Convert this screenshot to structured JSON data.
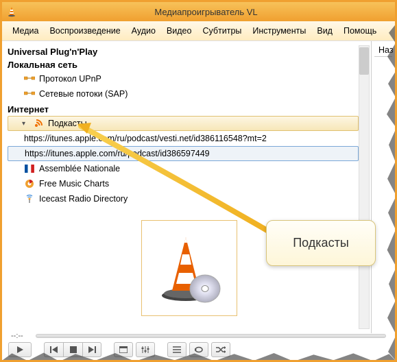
{
  "window": {
    "title": "Медиапроигрыватель VL"
  },
  "menubar": [
    "Медиа",
    "Воспроизведение",
    "Аудио",
    "Видео",
    "Субтитры",
    "Инструменты",
    "Вид",
    "Помощь"
  ],
  "sidebar": {
    "header": "Universal Plug'n'Play",
    "local_section": "Локальная сеть",
    "local_items": [
      "Протокол UPnP",
      "Сетевые потоки (SAP)"
    ],
    "internet_section": "Интернет",
    "podcasts_label": "Подкасты",
    "podcast_urls": [
      "https://itunes.apple.com/ru/podcast/vesti.net/id386116548?mt=2",
      "https://itunes.apple.com/ru/podcast/id386597449"
    ],
    "internet_items": [
      "Assemblée Nationale",
      "Free Music Charts",
      "Icecast Radio Directory"
    ]
  },
  "right_panel": {
    "column": "Наз"
  },
  "callout": {
    "text": "Подкасты"
  },
  "controls": {
    "elapsed": "--:--"
  }
}
